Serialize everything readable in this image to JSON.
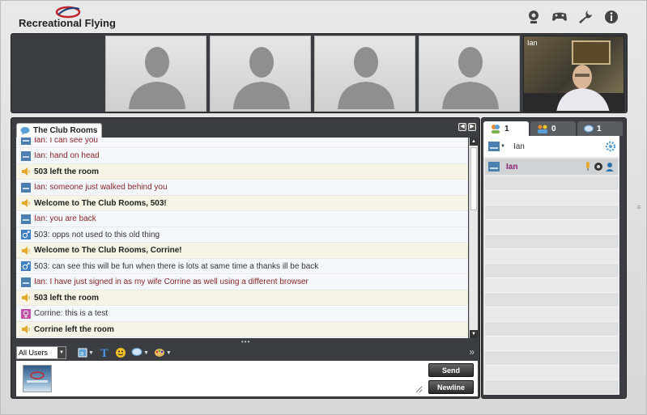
{
  "app": {
    "title": "Recreational Flying"
  },
  "header_icons": [
    "webcam-icon",
    "gamepad-icon",
    "wrench-icon",
    "info-icon"
  ],
  "video": {
    "live_user_name": "Ian"
  },
  "room": {
    "tab_label": "The Club Rooms",
    "messages": [
      {
        "type": "user",
        "text": "Ian: I can see you",
        "icon": "user-icon"
      },
      {
        "type": "user",
        "text": "Ian: hand on head",
        "icon": "user-icon"
      },
      {
        "type": "sys",
        "text": "503 left the room",
        "icon": "speaker-icon"
      },
      {
        "type": "user",
        "text": "Ian: someone just walked behind you",
        "icon": "user-icon"
      },
      {
        "type": "sys",
        "text": "Welcome to The Club Rooms, 503!",
        "icon": "speaker-icon"
      },
      {
        "type": "user",
        "text": "Ian: you are back",
        "icon": "user-icon"
      },
      {
        "type": "male",
        "text": "503: opps not used to this old thing",
        "icon": "male-icon"
      },
      {
        "type": "sys",
        "text": "Welcome to The Club Rooms, Corrine!",
        "icon": "speaker-icon"
      },
      {
        "type": "male",
        "text": "503: can see this will be fun when there is lots at same time a thanks ill be back",
        "icon": "male-icon"
      },
      {
        "type": "user",
        "text": "Ian: I have just signed in as my wife Corrine as well using a different browser",
        "icon": "user-icon"
      },
      {
        "type": "sys",
        "text": "503 left the room",
        "icon": "speaker-icon"
      },
      {
        "type": "female",
        "text": "Corrine: this is a test",
        "icon": "female-icon"
      },
      {
        "type": "sys",
        "text": "Corrine left the room",
        "icon": "speaker-icon"
      }
    ]
  },
  "toolbar": {
    "recipient": "All Users"
  },
  "compose": {
    "text": "",
    "send_label": "Send",
    "newline_label": "Newline"
  },
  "side": {
    "tabs": [
      {
        "icon": "users-icon",
        "count": "1"
      },
      {
        "icon": "group-icon",
        "count": "0"
      },
      {
        "icon": "chat-icon",
        "count": "1"
      }
    ],
    "self_name": "Ian",
    "users": [
      {
        "name": "Ian"
      }
    ]
  },
  "colors": {
    "frame": "#3a3d41",
    "username": "#8b2424",
    "list_username": "#8b2470"
  }
}
